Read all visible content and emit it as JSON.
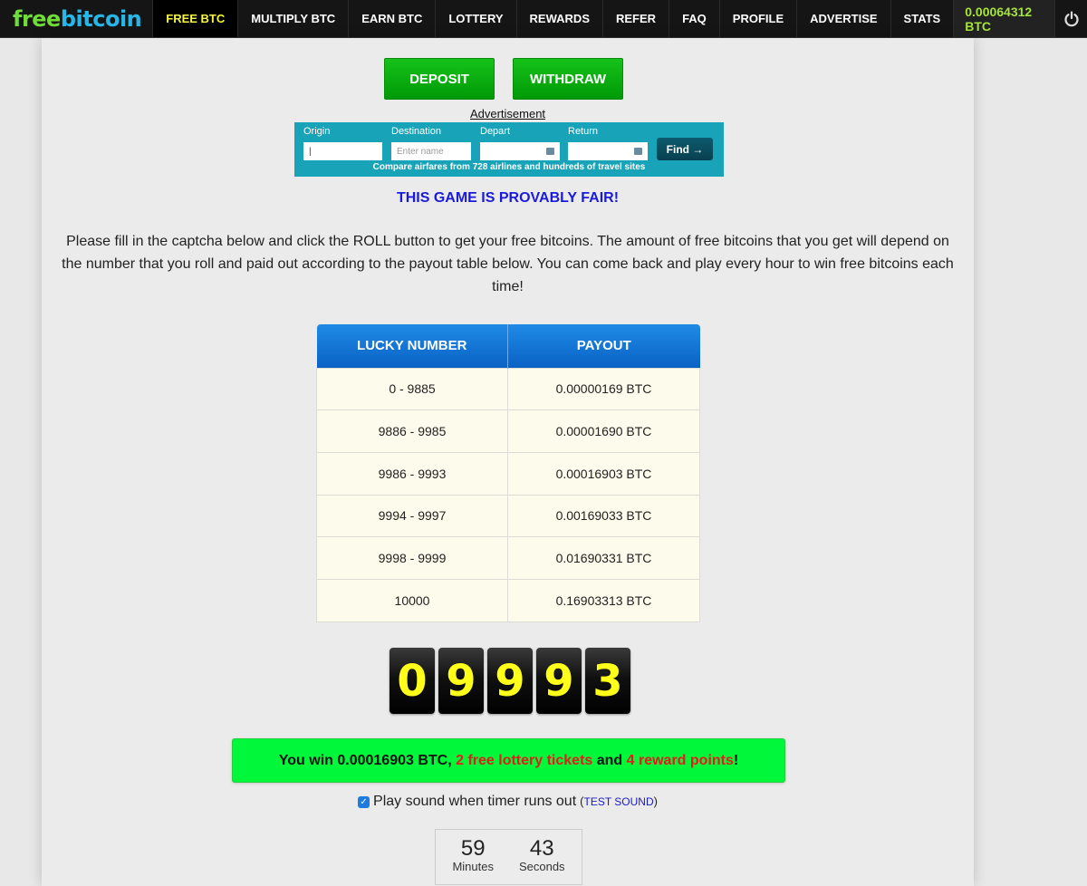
{
  "nav": {
    "logo": {
      "part1": "free",
      "part2": "bitcoin"
    },
    "items": [
      {
        "label": "FREE BTC",
        "active": true
      },
      {
        "label": "MULTIPLY BTC"
      },
      {
        "label": "EARN BTC"
      },
      {
        "label": "LOTTERY"
      },
      {
        "label": "REWARDS"
      },
      {
        "label": "REFER"
      },
      {
        "label": "FAQ"
      },
      {
        "label": "PROFILE"
      },
      {
        "label": "ADVERTISE"
      },
      {
        "label": "STATS"
      }
    ],
    "balance": "0.00064312 BTC",
    "power_icon": "power-icon"
  },
  "actions": {
    "deposit": "DEPOSIT",
    "withdraw": "WITHDRAW"
  },
  "ad": {
    "label": "Advertisement",
    "origin_label": "Origin",
    "origin_value": "|",
    "destination_label": "Destination",
    "destination_placeholder": "Enter name",
    "depart_label": "Depart",
    "return_label": "Return",
    "find": "Find →",
    "caption": "Compare airfares from 728 airlines and hundreds of travel sites"
  },
  "fair_text": "THIS GAME IS PROVABLY FAIR!",
  "intro": "Please fill in the captcha below and click the ROLL button to get your free bitcoins. The amount of free bitcoins that you get will depend on the number that you roll and paid out according to the payout table below. You can come back and play every hour to win free bitcoins each time!",
  "table": {
    "headers": [
      "LUCKY NUMBER",
      "PAYOUT"
    ],
    "rows": [
      [
        "0 - 9885",
        "0.00000169 BTC"
      ],
      [
        "9886 - 9985",
        "0.00001690 BTC"
      ],
      [
        "9986 - 9993",
        "0.00016903 BTC"
      ],
      [
        "9994 - 9997",
        "0.00169033 BTC"
      ],
      [
        "9998 - 9999",
        "0.01690331 BTC"
      ],
      [
        "10000",
        "0.16903313 BTC"
      ]
    ]
  },
  "roll": {
    "digits": [
      "0",
      "9",
      "9",
      "9",
      "3"
    ]
  },
  "win": {
    "prefix": "You win 0.00016903 BTC, ",
    "tickets": "2 free lottery tickets",
    "middle": " and ",
    "points": "4 reward points",
    "suffix": "!"
  },
  "sound": {
    "checked": true,
    "label": "Play sound when timer runs out",
    "open_paren": "(",
    "test": "TEST SOUND",
    "close_paren": ")"
  },
  "timer": {
    "minutes": "59",
    "minutes_label": "Minutes",
    "seconds": "43",
    "seconds_label": "Seconds"
  },
  "colors": {
    "nav_bg": "#151515",
    "active_nav": "#f5f542",
    "balance": "#a6e33b",
    "green_button": "#00a808",
    "ad_bg": "#18a3b8",
    "fair_blue": "#1a1adc",
    "table_header": "#1576d6",
    "table_row": "#fdfbec",
    "digit_yellow": "#ffff1a",
    "win_bg": "#00f73a",
    "win_red": "#e31c1c"
  }
}
